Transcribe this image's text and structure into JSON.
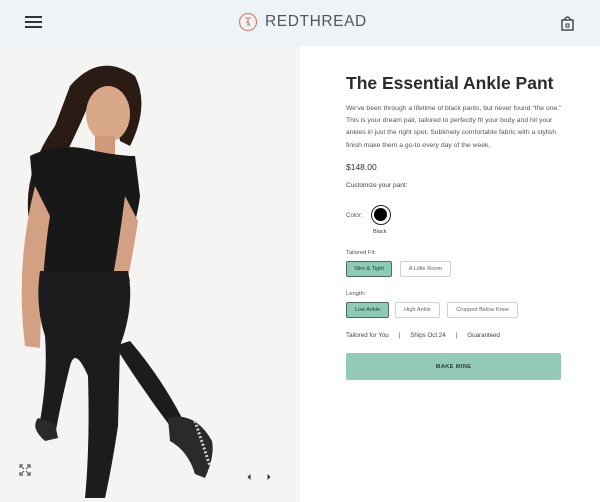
{
  "header": {
    "brand": "REDTHREAD",
    "colors": {
      "header_bg": "#eef3f8",
      "brand_mark": "#d8826a"
    }
  },
  "product": {
    "title": "The Essential Ankle Pant",
    "description": "We've been through a lifetime of black pants, but never found “the one.” This is your dream pair, tailored to perfectly fit your body and hit your ankles in just the right spot. Sublimely comfortable fabric with a stylish finish make them a go-to every day of the week.",
    "price": "$148.00",
    "customize_prompt": "Customize your pant:",
    "color": {
      "label": "Color:",
      "selected": "Black",
      "swatch_hex": "#000000"
    },
    "fit": {
      "label": "Tailored Fit:",
      "options": [
        {
          "label": "Slim & Tight",
          "selected": true
        },
        {
          "label": "A Little Room",
          "selected": false
        }
      ]
    },
    "length": {
      "label": "Length:",
      "options": [
        {
          "label": "Low Ankle",
          "selected": true
        },
        {
          "label": "High Ankle",
          "selected": false
        },
        {
          "label": "Cropped Below Knee",
          "selected": false
        }
      ]
    },
    "features": [
      "Tailored for You",
      "Ships Oct 24",
      "Guaranteed"
    ],
    "feature_separator": "|",
    "cta_label": "MAKE MINE",
    "accent_color": "#93cbb6"
  },
  "gallery": {
    "expand_icon": "expand-icon",
    "prev_icon": "chevron-left-icon",
    "next_icon": "chevron-right-icon"
  }
}
